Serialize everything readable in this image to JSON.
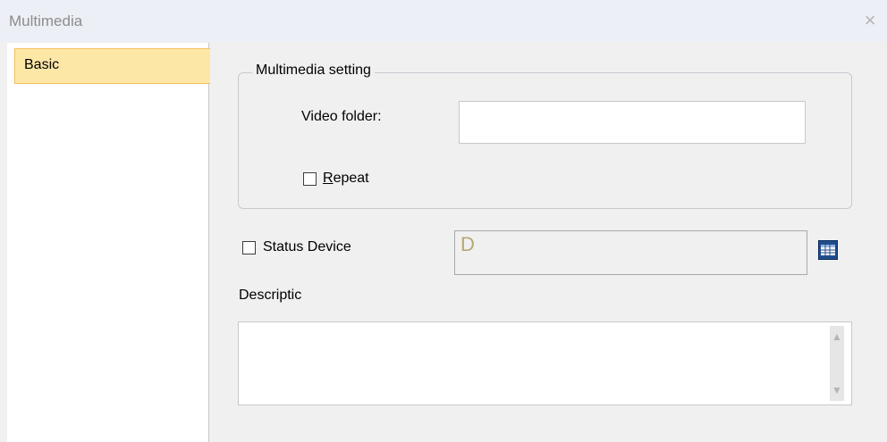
{
  "window": {
    "title": "Multimedia",
    "close_glyph": "×"
  },
  "nav": {
    "items": [
      {
        "label": "Basic",
        "selected": true
      }
    ]
  },
  "multimedia_setting": {
    "group_label": "Multimedia setting",
    "video_folder_label": "Video folder:",
    "video_folder_value": "",
    "repeat_label_mnemonic": "R",
    "repeat_label_rest": "epeat",
    "repeat_checked": false
  },
  "status_device": {
    "label": "Status Device",
    "checked": false,
    "value": "D",
    "picker_icon": "device-picker-icon"
  },
  "description": {
    "label": "Descriptic",
    "value": "",
    "scroll_up_glyph": "▲",
    "scroll_down_glyph": "▼"
  },
  "colors": {
    "selected_nav_bg": "#fde7a6",
    "selected_nav_border": "#f2c25f",
    "picker_icon_bg": "#1f4e8c"
  }
}
